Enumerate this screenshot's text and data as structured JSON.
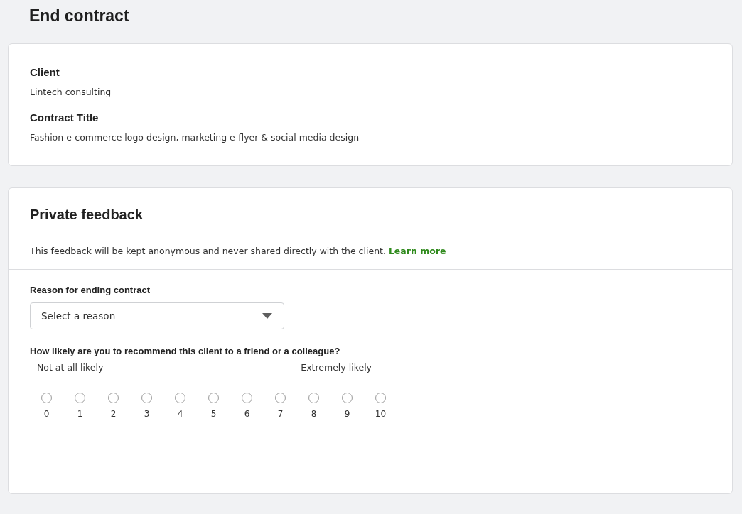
{
  "page": {
    "title": "End contract"
  },
  "contract": {
    "fields": [
      {
        "label": "Client",
        "value": "Lintech consulting"
      },
      {
        "label": "Contract Title",
        "value": "Fashion e-commerce logo design, marketing e-flyer & social media design"
      }
    ]
  },
  "feedback": {
    "title": "Private feedback",
    "note": "This feedback will be kept anonymous and never shared directly with the client.",
    "link": "Learn more",
    "reason": {
      "label": "Reason for ending contract",
      "placeholder": "Select a reason"
    },
    "recommend": {
      "question": "How likely are you to recommend this client to a friend or a colleague?",
      "low_label": "Not at all likely",
      "high_label": "Extremely likely",
      "options": [
        {
          "label": "0",
          "selected": false
        },
        {
          "label": "1",
          "selected": false
        },
        {
          "label": "2",
          "selected": false
        },
        {
          "label": "3",
          "selected": false
        },
        {
          "label": "4",
          "selected": false
        },
        {
          "label": "5",
          "selected": false
        },
        {
          "label": "6",
          "selected": false
        },
        {
          "label": "7",
          "selected": false
        },
        {
          "label": "8",
          "selected": false
        },
        {
          "label": "9",
          "selected": false
        },
        {
          "label": "10",
          "selected": false
        }
      ]
    }
  }
}
